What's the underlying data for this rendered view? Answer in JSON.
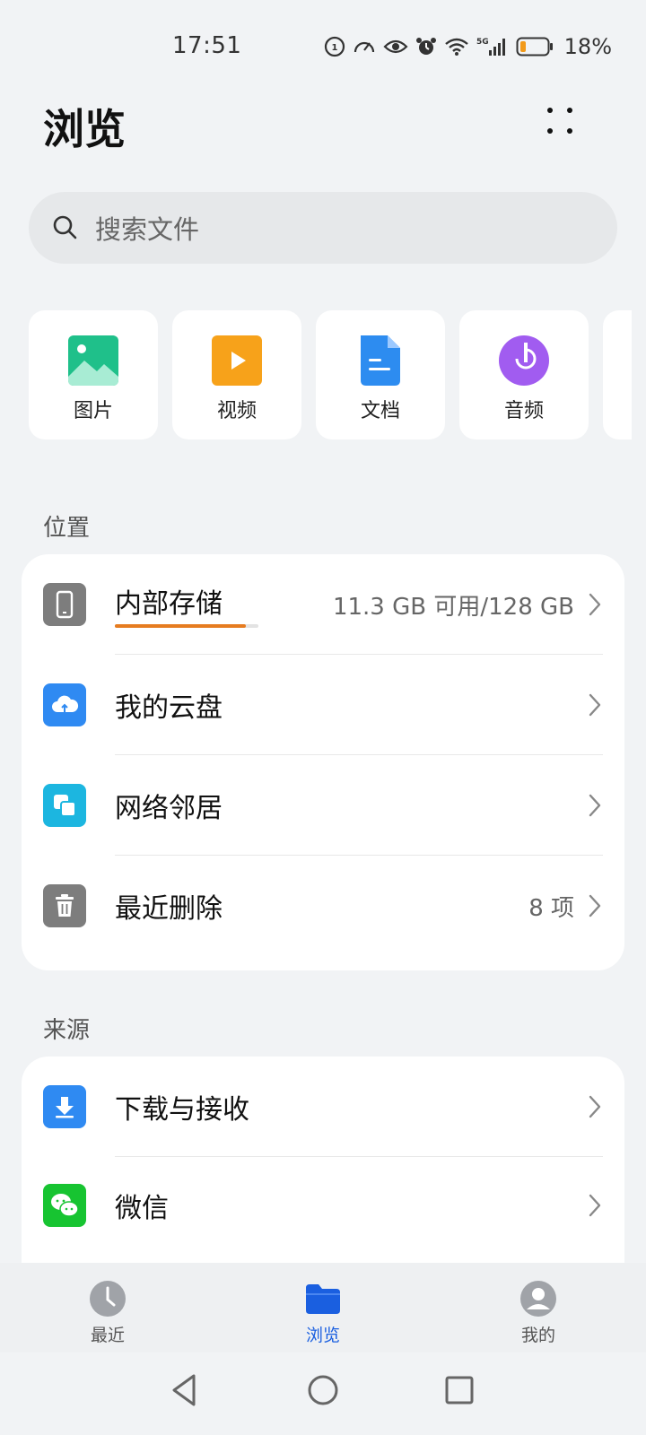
{
  "status": {
    "time": "17:51",
    "battery": "18%",
    "network": "5G"
  },
  "header": {
    "title": "浏览"
  },
  "search": {
    "placeholder": "搜索文件"
  },
  "categories": [
    {
      "label": "图片",
      "icon": "image-icon",
      "color": "#1fc08a"
    },
    {
      "label": "视频",
      "icon": "video-icon",
      "color": "#f7a21a"
    },
    {
      "label": "文档",
      "icon": "document-icon",
      "color": "#2d8cf0"
    },
    {
      "label": "音频",
      "icon": "audio-icon",
      "color": "#a15cf0"
    }
  ],
  "locations": {
    "title": "位置",
    "items": [
      {
        "label": "内部存储",
        "value": "11.3 GB 可用/128 GB",
        "icon": "phone-icon",
        "usage_percent": 91
      },
      {
        "label": "我的云盘",
        "value": "",
        "icon": "cloud-icon"
      },
      {
        "label": "网络邻居",
        "value": "",
        "icon": "network-icon"
      },
      {
        "label": "最近删除",
        "value": "8 项",
        "icon": "trash-icon"
      }
    ]
  },
  "sources": {
    "title": "来源",
    "items": [
      {
        "label": "下载与接收",
        "icon": "download-icon"
      },
      {
        "label": "微信",
        "icon": "wechat-icon"
      }
    ]
  },
  "bottom_nav": [
    {
      "label": "最近",
      "icon": "clock-icon",
      "active": false
    },
    {
      "label": "浏览",
      "icon": "folder-icon",
      "active": true
    },
    {
      "label": "我的",
      "icon": "profile-icon",
      "active": false
    }
  ],
  "colors": {
    "accent": "#1a5fe0",
    "storage_bar": "#e67c20"
  }
}
